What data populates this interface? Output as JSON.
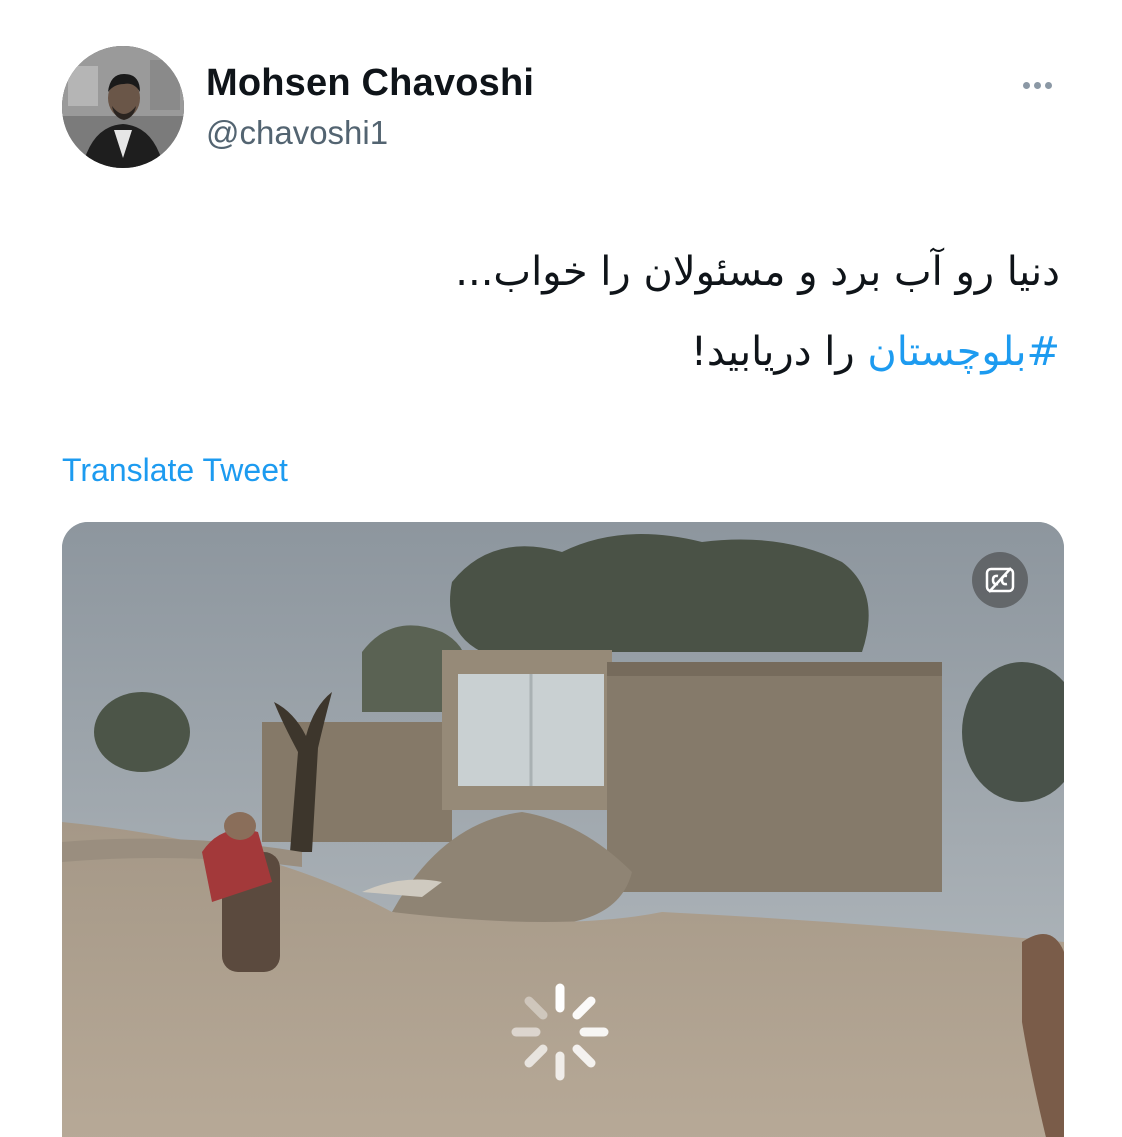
{
  "author": {
    "display_name": "Mohsen Chavoshi",
    "handle": "@chavoshi1",
    "avatar_icon": "profile-photo"
  },
  "tweet": {
    "line1": "دنیا رو آب برد و مسئولان را خواب...",
    "hashtag": "#بلوچستان",
    "line2_rest": " را دریابید!"
  },
  "translate_label": "Translate Tweet",
  "media": {
    "type": "video",
    "controls": [
      "captions-icon",
      "loading-spinner-icon"
    ]
  },
  "colors": {
    "link": "#1d9bf0",
    "text": "#0f1419",
    "secondary": "#536471"
  }
}
